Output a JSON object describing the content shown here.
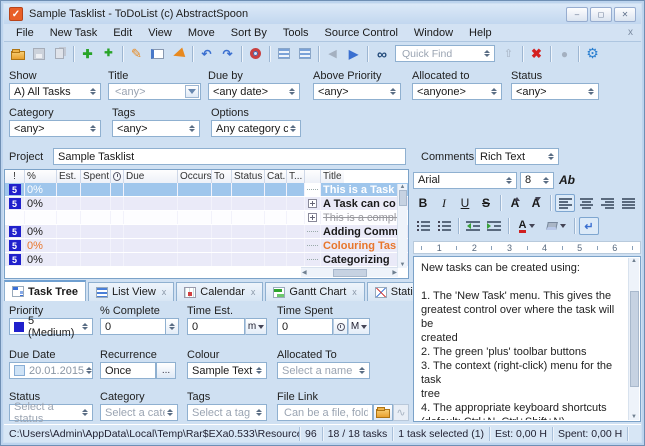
{
  "window": {
    "title": "Sample Tasklist - ToDoList (c) AbstractSpoon"
  },
  "glyphs": {
    "check": "✓",
    "minimize": "‒",
    "maximize": "◻",
    "close": "✕",
    "menu_close": "x",
    "plus": "✚",
    "pencil": "✎",
    "undo": "↶",
    "redo": "↷",
    "prev": "◀",
    "next": "▶",
    "binoculars": "∞",
    "upload": "⇧",
    "delete": "✖",
    "gear": "⚙",
    "up_arrow": "▲",
    "down_arrow": "▼",
    "left_arrow": "◀",
    "right_arrow": "▶",
    "bold": "B",
    "italic": "I",
    "underline": "U",
    "strike": "S",
    "font_grow": "A",
    "font_shrink": "A",
    "font_color": "A",
    "wrap": "↵",
    "ab": "Ab",
    "ellipsis": "..."
  },
  "menu": {
    "items": [
      "File",
      "New Task",
      "Edit",
      "View",
      "Move",
      "Sort By",
      "Tools",
      "Source Control",
      "Window",
      "Help"
    ]
  },
  "toolbar": {
    "quick_find": {
      "placeholder": "Quick Find"
    }
  },
  "filters": {
    "show": {
      "label": "Show",
      "value": "A)  All Tasks"
    },
    "title": {
      "label": "Title",
      "placeholder": "<any>"
    },
    "due_by": {
      "label": "Due by",
      "value": "<any date>"
    },
    "above_priority": {
      "label": "Above Priority",
      "value": "<any>"
    },
    "allocated_to": {
      "label": "Allocated to",
      "value": "<anyone>"
    },
    "status": {
      "label": "Status",
      "value": "<any>"
    },
    "category": {
      "label": "Category",
      "value": "<any>"
    },
    "tags": {
      "label": "Tags",
      "value": "<any>"
    },
    "options": {
      "label": "Options",
      "value": "Any category c..."
    }
  },
  "project": {
    "label": "Project",
    "value": "Sample Tasklist"
  },
  "tasklist": {
    "columns": {
      "priority": "!",
      "percent": "%",
      "est": "Est.",
      "spent": "Spent",
      "due": "Due",
      "occurs": "Occurs",
      "to": "To",
      "status": "Status",
      "cat": "Cat.",
      "t": "T...",
      "title": "Title"
    },
    "rows": [
      {
        "priority": "5",
        "percent": "0%",
        "title": "This is a Task"
      },
      {
        "priority": "5",
        "percent": "0%",
        "title": "A Task can co"
      },
      {
        "priority": "",
        "percent": "",
        "title": "This is a complet"
      },
      {
        "priority": "5",
        "percent": "0%",
        "title": "Adding Comm"
      },
      {
        "priority": "5",
        "percent": "0%",
        "title": "Colouring Tas"
      },
      {
        "priority": "5",
        "percent": "0%",
        "title": "Categorizing"
      }
    ]
  },
  "tabs": {
    "task_tree": "Task Tree",
    "list_view": "List View",
    "calendar": "Calendar",
    "gantt": "Gantt Chart",
    "statistics": "Statistics",
    "close": "x"
  },
  "attributes": {
    "priority": {
      "label": "Priority",
      "value": "5 (Medium)"
    },
    "percent": {
      "label": "% Complete",
      "value": "0"
    },
    "time_est": {
      "label": "Time Est.",
      "value": "0",
      "unit": "m"
    },
    "time_spent": {
      "label": "Time Spent",
      "value": "0",
      "unit": "M"
    },
    "due_date": {
      "label": "Due Date",
      "value": "20.01.2015"
    },
    "recurrence": {
      "label": "Recurrence",
      "value": "Once"
    },
    "colour": {
      "label": "Colour",
      "value": "Sample Text"
    },
    "allocated_to": {
      "label": "Allocated To",
      "placeholder": "Select a name"
    },
    "status": {
      "label": "Status",
      "placeholder": "Select a status"
    },
    "category": {
      "label": "Category",
      "placeholder": "Select a catego"
    },
    "tags": {
      "label": "Tags",
      "placeholder": "Select a tag"
    },
    "file_link": {
      "label": "File Link",
      "placeholder": "Can be a file, folder,"
    }
  },
  "comments": {
    "label": "Comments",
    "format": "Rich Text",
    "font": "Arial",
    "size": "8",
    "ruler": [
      "1",
      "2",
      "3",
      "4",
      "5",
      "6"
    ],
    "text": "New tasks can be created using:\n\n1. The 'New Task' menu. This gives the\ngreatest control over where the task will be\ncreated\n2. The green 'plus' toolbar buttons\n3. The context (right-click) menu for the task\ntree\n4. The appropriate keyboard shortcuts\n(default: Ctrl+N, Ctrl+Shift+N)\n\nNote: If during the creation of a new task you\ndecide that it's not what you want (or where"
  },
  "statusbar": {
    "path": "C:\\Users\\Admin\\AppData\\Local\\Temp\\Rar$EXa0.533\\Resources\\TaskLists\\Introducti",
    "pane2": "96",
    "tasks": "18 / 18 tasks",
    "selected": "1 task selected (1)",
    "est": "Est: 0,00 H",
    "spent": "Spent: 0,00 H"
  },
  "colors": {
    "accent_blue": "#2a6fd0",
    "priority_blue": "#2020cc",
    "selected_row": "#9fc6ec",
    "orange_task": "#e8762c",
    "delete_red": "#d42020",
    "new_green": "#28a428"
  }
}
